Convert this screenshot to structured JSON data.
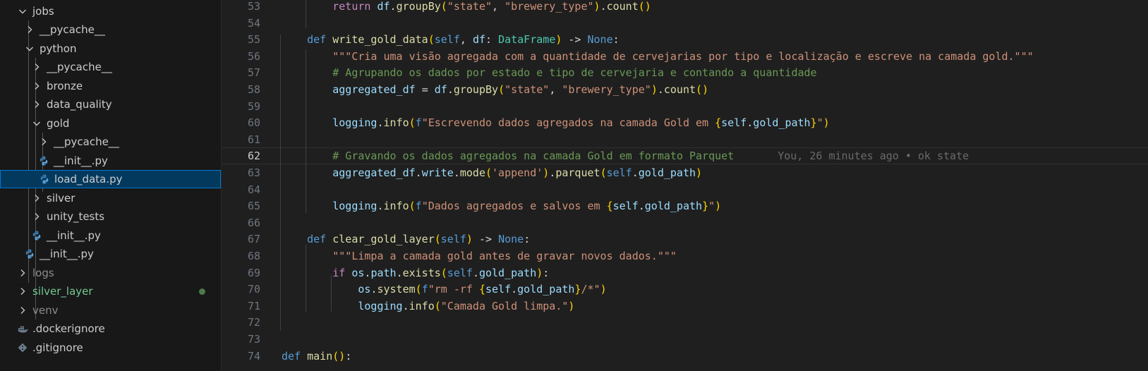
{
  "explorer": {
    "items": [
      {
        "label": "jobs",
        "type": "folder-open"
      },
      {
        "label": "__pycache__",
        "type": "folder"
      },
      {
        "label": "python",
        "type": "folder-open"
      },
      {
        "label": "__pycache__",
        "type": "folder"
      },
      {
        "label": "bronze",
        "type": "folder"
      },
      {
        "label": "data_quality",
        "type": "folder"
      },
      {
        "label": "gold",
        "type": "folder-open"
      },
      {
        "label": "__pycache__",
        "type": "folder"
      },
      {
        "label": "__init__.py",
        "type": "python-file"
      },
      {
        "label": "load_data.py",
        "type": "python-file",
        "selected": true
      },
      {
        "label": "silver",
        "type": "folder"
      },
      {
        "label": "unity_tests",
        "type": "folder"
      },
      {
        "label": "__init__.py",
        "type": "python-file"
      },
      {
        "label": "__init__.py",
        "type": "python-file"
      },
      {
        "label": "logs",
        "type": "folder",
        "muted": true
      },
      {
        "label": "silver_layer",
        "type": "folder",
        "git_status": "modified"
      },
      {
        "label": "venv",
        "type": "folder",
        "muted": true
      },
      {
        "label": ".dockerignore",
        "type": "docker-file"
      },
      {
        "label": ".gitignore",
        "type": "git-file"
      }
    ]
  },
  "editor": {
    "active_line": "62",
    "blame_text": "You, 26 minutes ago • ok state",
    "lines": [
      {
        "num": "53",
        "text": "        return df.groupBy(\"state\", \"brewery_type\").count()"
      },
      {
        "num": "54",
        "text": ""
      },
      {
        "num": "55",
        "text": "    def write_gold_data(self, df: DataFrame) -> None:"
      },
      {
        "num": "56",
        "text": "        \"\"\"Cria uma visão agregada com a quantidade de cervejarias por tipo e localização e escreve na camada gold.\"\"\""
      },
      {
        "num": "57",
        "text": "        # Agrupando os dados por estado e tipo de cervejaria e contando a quantidade"
      },
      {
        "num": "58",
        "text": "        aggregated_df = df.groupBy(\"state\", \"brewery_type\").count()"
      },
      {
        "num": "59",
        "text": ""
      },
      {
        "num": "60",
        "text": "        logging.info(f\"Escrevendo dados agregados na camada Gold em {self.gold_path}\")"
      },
      {
        "num": "61",
        "text": ""
      },
      {
        "num": "62",
        "text": "        # Gravando os dados agregados na camada Gold em formato Parquet"
      },
      {
        "num": "63",
        "text": "        aggregated_df.write.mode('append').parquet(self.gold_path)"
      },
      {
        "num": "64",
        "text": ""
      },
      {
        "num": "65",
        "text": "        logging.info(f\"Dados agregados e salvos em {self.gold_path}\")"
      },
      {
        "num": "66",
        "text": ""
      },
      {
        "num": "67",
        "text": "    def clear_gold_layer(self) -> None:"
      },
      {
        "num": "68",
        "text": "        \"\"\"Limpa a camada gold antes de gravar novos dados.\"\"\""
      },
      {
        "num": "69",
        "text": "        if os.path.exists(self.gold_path):"
      },
      {
        "num": "70",
        "text": "            os.system(f\"rm -rf {self.gold_path}/*\")"
      },
      {
        "num": "71",
        "text": "            logging.info(\"Camada Gold limpa.\")"
      },
      {
        "num": "72",
        "text": ""
      },
      {
        "num": "73",
        "text": ""
      },
      {
        "num": "74",
        "text": "def main():"
      }
    ]
  },
  "colors": {
    "sidebar_bg": "#181818",
    "editor_bg": "#1f1f1f",
    "selection_bg": "#04395e",
    "selection_border": "#0078d4",
    "git_modified": "#73c991"
  }
}
